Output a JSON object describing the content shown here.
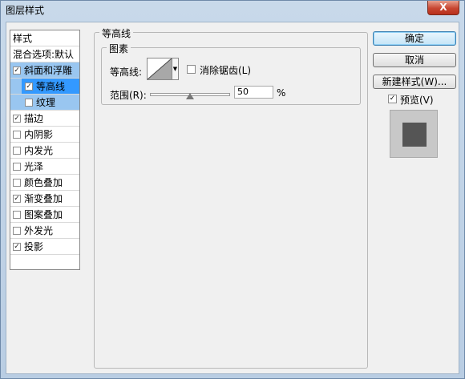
{
  "window": {
    "title": "图层样式",
    "close_label": "X"
  },
  "sidebar": {
    "header": "样式",
    "blend_options": "混合选项:默认",
    "items": [
      {
        "label": "斜面和浮雕",
        "checked": true
      },
      {
        "label": "等高线",
        "checked": true
      },
      {
        "label": "纹理",
        "checked": false
      },
      {
        "label": "描边",
        "checked": true
      },
      {
        "label": "内阴影",
        "checked": false
      },
      {
        "label": "内发光",
        "checked": false
      },
      {
        "label": "光泽",
        "checked": false
      },
      {
        "label": "颜色叠加",
        "checked": false
      },
      {
        "label": "渐变叠加",
        "checked": true
      },
      {
        "label": "图案叠加",
        "checked": false
      },
      {
        "label": "外发光",
        "checked": false
      },
      {
        "label": "投影",
        "checked": true
      }
    ]
  },
  "contour_panel": {
    "group_title": "等高线",
    "subgroup_title": "图素",
    "contour_label": "等高线:",
    "anti_alias_label": "消除锯齿(L)",
    "anti_alias_checked": false,
    "range_label": "范围(R):",
    "range_value": "50",
    "range_unit": "%",
    "range_fraction": 0.5
  },
  "buttons": {
    "ok": "确定",
    "cancel": "取消",
    "new_style": "新建样式(W)...",
    "preview_label": "预览(V)",
    "preview_checked": true
  },
  "colors": {
    "active_row": "#3399ff",
    "selected_row": "#99c6f0",
    "preview_swatch": "#555555"
  }
}
